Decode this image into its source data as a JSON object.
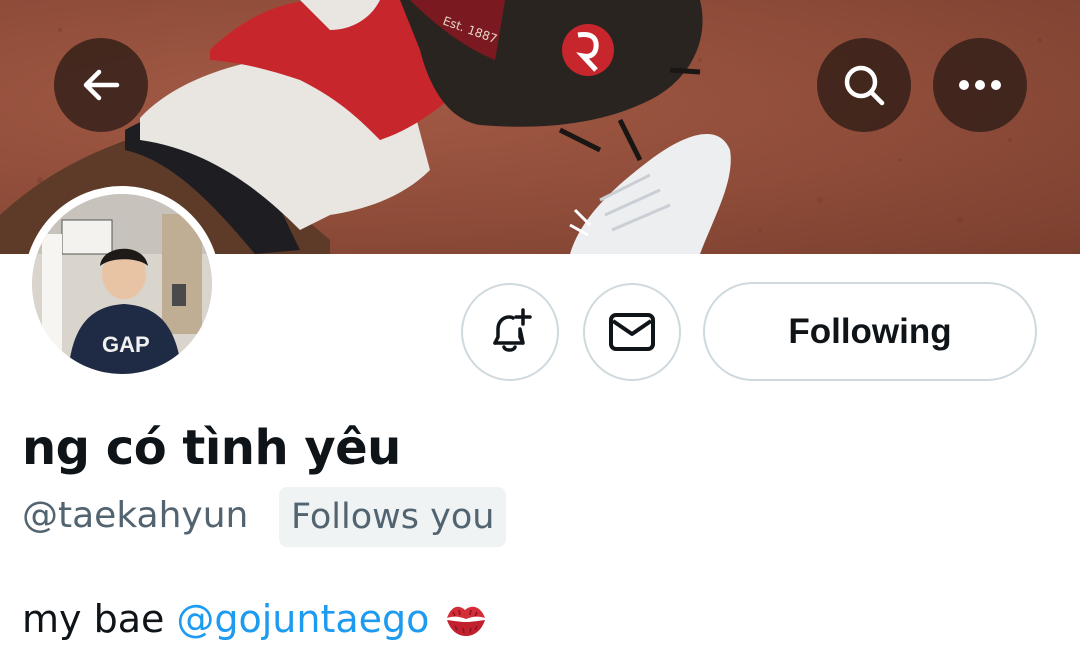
{
  "header": {
    "back_icon": "arrow-left-icon",
    "search_icon": "search-icon",
    "more_icon": "more-horizontal-icon"
  },
  "banner": {
    "glove_brand_text": "Est. 1887"
  },
  "profile": {
    "display_name": "ng có tình yêu",
    "handle": "@taekahyun",
    "follows_you_badge": "Follows you",
    "bio_text": "my bae",
    "bio_mention": "@gojuntaego",
    "bio_emoji_icon": "kiss-mark-icon",
    "avatar_shirt_text": "GAP"
  },
  "actions": {
    "notify_icon": "bell-plus-icon",
    "message_icon": "envelope-icon",
    "following_label": "Following"
  },
  "colors": {
    "link": "#1d9bf0",
    "muted_text": "#536471",
    "badge_bg": "#eff3f4",
    "border": "#cfd9de"
  }
}
